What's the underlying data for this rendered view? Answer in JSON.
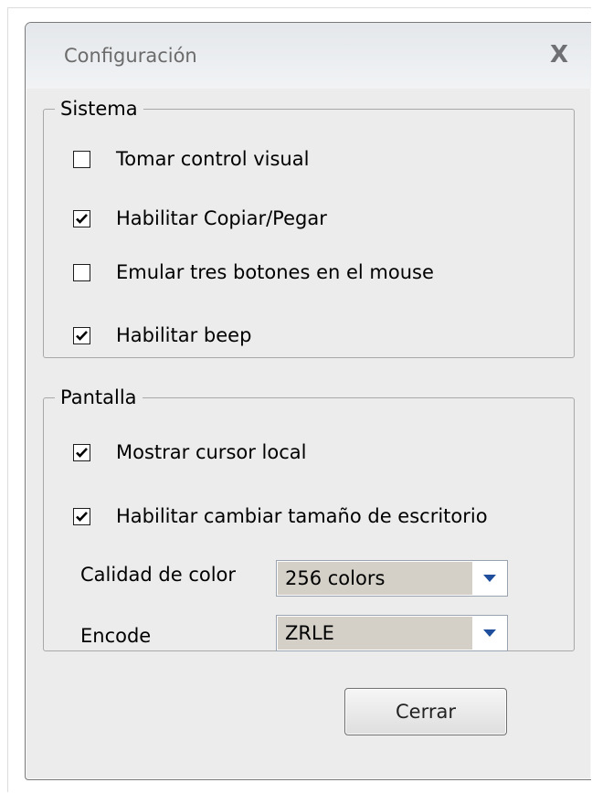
{
  "dialog": {
    "title": "Configuración",
    "close_icon": "x-icon",
    "close_glyph": "X"
  },
  "sistema": {
    "legend": "Sistema",
    "options": [
      {
        "label": "Tomar control visual",
        "checked": false
      },
      {
        "label": "Habilitar Copiar/Pegar",
        "checked": true
      },
      {
        "label": "Emular tres botones en el mouse",
        "checked": false
      },
      {
        "label": "Habilitar beep",
        "checked": true
      }
    ]
  },
  "pantalla": {
    "legend": "Pantalla",
    "options": [
      {
        "label": "Mostrar cursor local",
        "checked": true
      },
      {
        "label": "Habilitar cambiar tamaño de escritorio",
        "checked": true
      }
    ],
    "color_quality": {
      "label": "Calidad de color",
      "value": "256 colors"
    },
    "encode": {
      "label": "Encode",
      "value": "ZRLE"
    }
  },
  "footer": {
    "close_button_label": "Cerrar"
  },
  "colors": {
    "dropdown_arrow": "#1f4f9c",
    "select_fill": "#d4d0c8",
    "dialog_bg": "#ececec"
  }
}
